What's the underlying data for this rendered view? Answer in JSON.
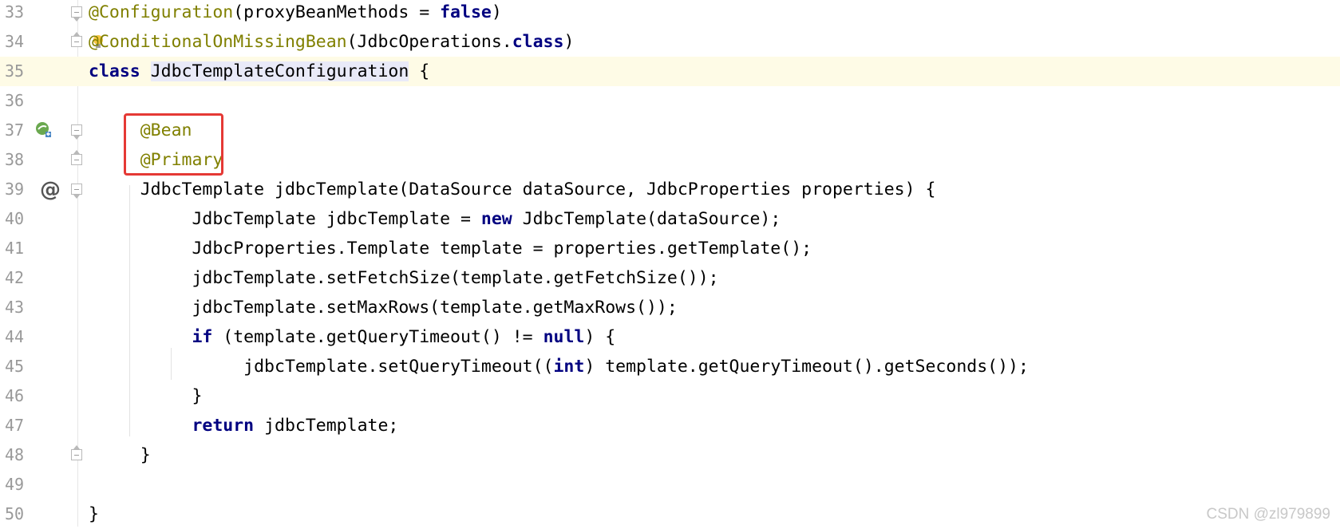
{
  "lines": [
    {
      "n": "33",
      "parts": [
        [
          "ann",
          "@Configuration"
        ],
        [
          "",
          "(proxyBeanMethods = "
        ],
        [
          "kw",
          "false"
        ],
        [
          "",
          ")"
        ]
      ]
    },
    {
      "n": "34",
      "parts": [
        [
          "ann",
          "@ConditionalOnMissingBean"
        ],
        [
          "",
          "(JdbcOperations."
        ],
        [
          "kw",
          "class"
        ],
        [
          "",
          ")"
        ]
      ]
    },
    {
      "n": "35",
      "parts": [
        [
          "kw",
          "class"
        ],
        [
          "",
          " "
        ],
        [
          "cls",
          "JdbcTemplateConfiguration"
        ],
        [
          "",
          " {"
        ]
      ]
    },
    {
      "n": "36",
      "parts": []
    },
    {
      "n": "37",
      "parts": [
        [
          "",
          "     "
        ],
        [
          "ann",
          "@Bean"
        ]
      ]
    },
    {
      "n": "38",
      "parts": [
        [
          "",
          "     "
        ],
        [
          "ann",
          "@Primary"
        ]
      ]
    },
    {
      "n": "39",
      "parts": [
        [
          "",
          "     JdbcTemplate jdbcTemplate(DataSource dataSource, JdbcProperties properties) {"
        ]
      ]
    },
    {
      "n": "40",
      "parts": [
        [
          "",
          "          JdbcTemplate jdbcTemplate = "
        ],
        [
          "kw",
          "new"
        ],
        [
          "",
          " JdbcTemplate(dataSource);"
        ]
      ]
    },
    {
      "n": "41",
      "parts": [
        [
          "",
          "          JdbcProperties.Template template = properties.getTemplate();"
        ]
      ]
    },
    {
      "n": "42",
      "parts": [
        [
          "",
          "          jdbcTemplate.setFetchSize(template.getFetchSize());"
        ]
      ]
    },
    {
      "n": "43",
      "parts": [
        [
          "",
          "          jdbcTemplate.setMaxRows(template.getMaxRows());"
        ]
      ]
    },
    {
      "n": "44",
      "parts": [
        [
          "",
          "          "
        ],
        [
          "kw",
          "if"
        ],
        [
          "",
          " (template.getQueryTimeout() != "
        ],
        [
          "kw",
          "null"
        ],
        [
          "",
          ") {"
        ]
      ]
    },
    {
      "n": "45",
      "parts": [
        [
          "",
          "               jdbcTemplate.setQueryTimeout(("
        ],
        [
          "kw",
          "int"
        ],
        [
          "",
          ") template.getQueryTimeout().getSeconds());"
        ]
      ]
    },
    {
      "n": "46",
      "parts": [
        [
          "",
          "          }"
        ]
      ]
    },
    {
      "n": "47",
      "parts": [
        [
          "",
          "          "
        ],
        [
          "kw",
          "return"
        ],
        [
          "",
          " jdbcTemplate;"
        ]
      ]
    },
    {
      "n": "48",
      "parts": [
        [
          "",
          "     }"
        ]
      ]
    },
    {
      "n": "49",
      "parts": []
    },
    {
      "n": "50",
      "parts": [
        [
          "",
          "}"
        ]
      ]
    }
  ],
  "current_line": "35",
  "watermark": "CSDN @zl979899",
  "gutter_icons": {
    "37": "bean-navigate-icon",
    "39": "implemented-at-icon",
    "34": "lightbulb-icon"
  }
}
